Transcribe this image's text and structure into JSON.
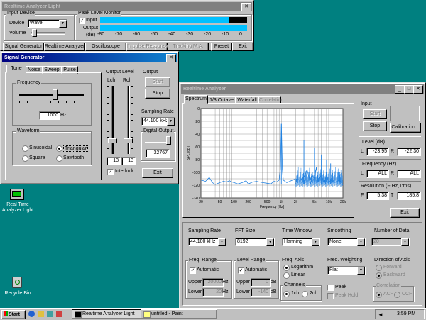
{
  "main_window": {
    "title": "Realtime Analyzer Light",
    "input_device": {
      "group_label": "Input Device",
      "device_label": "Device",
      "device_value": "Wave",
      "volume_label": "Volume"
    },
    "peak_monitor": {
      "group_label": "Peak Level Monitor",
      "input_label": "Input",
      "input_checked": true,
      "output_label": "Output",
      "input_level": 0.88,
      "output_level": 1.0,
      "unit_label": "(dB)",
      "scale": [
        "-80",
        "-70",
        "-60",
        "-50",
        "-40",
        "-30",
        "-20",
        "-10",
        "0"
      ]
    },
    "toolbar": {
      "signal_generator": "Signal Generator",
      "realtime_analyzer": "Realtime Analyzer",
      "oscilloscope": "Oscilloscope",
      "impulse_response": "Impulse Response",
      "tracking_mode": "Tracking M.A.",
      "preset": "Preset",
      "exit": "Exit"
    }
  },
  "signal_generator": {
    "title": "Signal Generator",
    "tabs": [
      "Tone",
      "Noise",
      "Sweep",
      "Pulse"
    ],
    "frequency_label": "Frequency",
    "frequency_value": "1000",
    "frequency_unit": "Hz",
    "waveform_label": "Waveform",
    "waveforms": [
      "Sinusoidal",
      "Triangular",
      "Square",
      "Sawtooth"
    ],
    "selected_waveform": "Triangular",
    "output_level_label": "Output Level",
    "lch_label": "Lch",
    "rch_label": "Rch",
    "lch_value": "13",
    "rch_value": "13",
    "interlock_label": "Interlock",
    "output_label": "Output",
    "start_label": "Start",
    "stop_label": "Stop",
    "sampling_rate_label": "Sampling Rate",
    "sampling_rate_value": "44.100 kHz",
    "digital_output_label": "Digital Output",
    "digital_output_value": "32767",
    "exit_label": "Exit"
  },
  "analyzer": {
    "title": "Realtime Analyzer",
    "tabs": [
      "Spectrum",
      "1/3 Octave",
      "Waterfall",
      "Correlation"
    ],
    "input_label": "Input",
    "start_label": "Start",
    "stop_label": "Stop",
    "calibration_label": "Calibration...",
    "level_label": "Level (dB)",
    "level_l": "-23.95",
    "level_r": "-22.30",
    "frequency_label": "Frequency (Hz)",
    "freq_l": "ALL",
    "freq_r": "ALL",
    "resolution_label": "Resolution (F:Hz,T:ms)",
    "res_f": "5.38",
    "res_t": "185.8",
    "l_label": "L",
    "r_label": "R",
    "f_label": "F",
    "t_label": "T",
    "exit_label": "Exit",
    "settings": {
      "sampling_rate_label": "Sampling Rate",
      "sampling_rate_value": "44.100 kHz",
      "fft_size_label": "FFT Size",
      "fft_size_value": "8192",
      "time_window_label": "Time Window",
      "time_window_value": "Hanning",
      "smoothing_label": "Smoothing",
      "smoothing_value": "None",
      "num_data_label": "Number of Data",
      "num_data_value": "20",
      "freq_range_label": "Freq. Range",
      "freq_auto_label": "Automatic",
      "freq_upper_label": "Upper",
      "freq_upper_value": "20000",
      "freq_lower_label": "Lower",
      "freq_lower_value": "20",
      "hz_label": "Hz",
      "level_range_label": "Level Range",
      "level_auto_label": "Automatic",
      "level_upper_label": "Upper",
      "level_upper_value": "0",
      "level_lower_label": "Lower",
      "level_lower_value": "-140",
      "db_label": "dB",
      "freq_axis_label": "Freq. Axis",
      "logarithm_label": "Logarithm",
      "linear_label": "Linear",
      "freq_weighting_label": "Freq. Weighting",
      "freq_weighting_value": "Flat",
      "direction_label": "Direction of Axis",
      "forward_label": "Forward",
      "backward_label": "Backward",
      "channels_label": "Channels",
      "ch1_label": "1ch",
      "ch2_label": "2ch",
      "peak_label": "Peak",
      "peak_hold_label": "Peak Hold",
      "correlation_label": "Correlation",
      "acf_label": "ACF",
      "ccf_label": "CCF"
    }
  },
  "chart_data": {
    "type": "line",
    "ylabel": "SPL [dB]",
    "xlabel": "Frequency [Hz]",
    "xscale": "log",
    "xlim": [
      20,
      20000
    ],
    "ylim": [
      -140,
      0
    ],
    "grid": true,
    "x_ticks": [
      "20",
      "50",
      "100",
      "200",
      "500",
      "1k",
      "2k",
      "5k",
      "10k",
      "20k"
    ],
    "y_ticks": [
      "0",
      "-20",
      "-40",
      "-60",
      "-80",
      "-100",
      "-120",
      "-140"
    ],
    "series": [
      {
        "color": "#2080e0",
        "x": [
          20,
          25,
          30,
          35,
          40,
          50,
          60,
          70,
          80,
          90,
          100,
          120,
          150,
          180,
          200,
          250,
          300,
          400,
          500,
          600,
          700,
          800,
          900,
          950,
          1000,
          1050,
          1100,
          1300,
          1500,
          2000,
          2500,
          3000,
          3500,
          4000,
          4500,
          5000,
          5500,
          6000,
          7000,
          8000,
          9000,
          10000,
          11000,
          13000,
          15000,
          17000,
          20000
        ],
        "y": [
          -112,
          -114,
          -108,
          -116,
          -119,
          -116,
          -114,
          -115,
          -113,
          -115,
          -116,
          -118,
          -116,
          -113,
          -118,
          -115,
          -114,
          -116,
          -117,
          -118,
          -114,
          -115,
          -112,
          -95,
          -24,
          -95,
          -112,
          -116,
          -114,
          -110,
          -112,
          -108,
          -96,
          -112,
          -104,
          -110,
          -92,
          -114,
          -104,
          -118,
          -102,
          -118,
          -112,
          -116,
          -114,
          -112,
          -120
        ]
      }
    ],
    "spikes": [
      {
        "x": 1000,
        "y": -24
      },
      {
        "x": 3000,
        "y": -50
      },
      {
        "x": 5000,
        "y": -62
      },
      {
        "x": 7000,
        "y": -72
      },
      {
        "x": 9000,
        "y": -80
      },
      {
        "x": 11000,
        "y": -86
      },
      {
        "x": 13000,
        "y": -92
      },
      {
        "x": 15000,
        "y": -96
      },
      {
        "x": 17000,
        "y": -100
      },
      {
        "x": 19000,
        "y": -104
      }
    ]
  },
  "desktop": {
    "icons": [
      {
        "label_line1": "Real Time",
        "label_line2": "Analyzer Light"
      },
      {
        "label_line1": "Recycle Bin",
        "label_line2": ""
      }
    ]
  },
  "taskbar": {
    "start_label": "Start",
    "tasks": [
      "Realtime Analyzer Light",
      "untitled - Paint"
    ],
    "clock": "3:59 PM"
  }
}
